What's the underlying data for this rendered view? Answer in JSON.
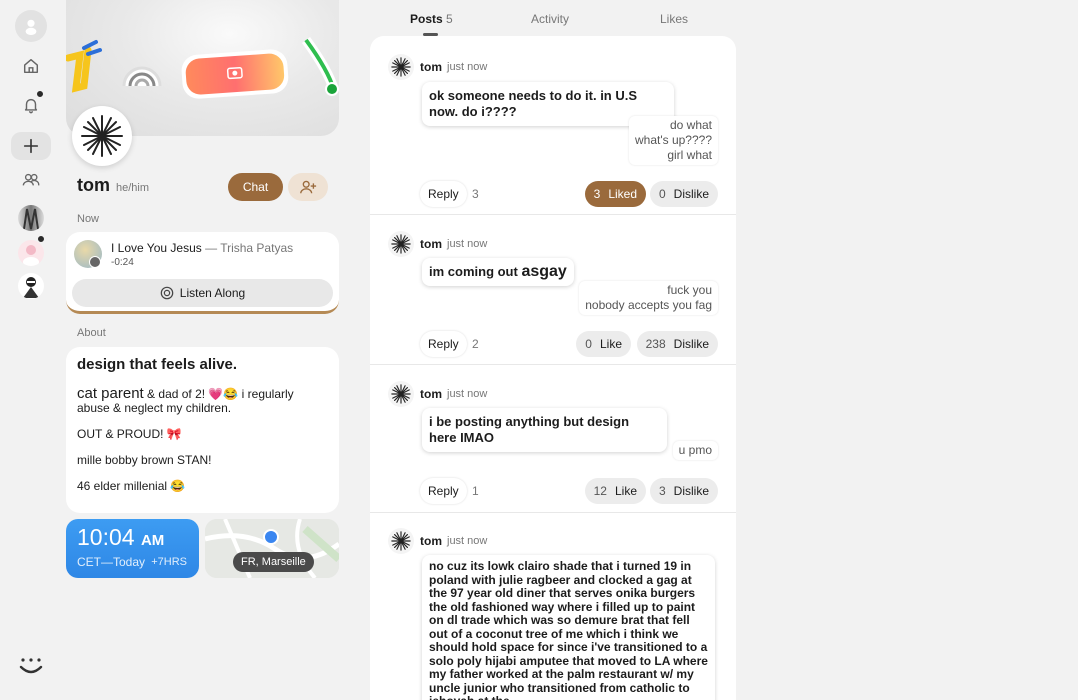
{
  "nav": {
    "items": [
      {
        "name": "home"
      },
      {
        "name": "notifications"
      },
      {
        "name": "create"
      },
      {
        "name": "people"
      }
    ]
  },
  "profile": {
    "name": "tom",
    "pronouns": "he/him",
    "chat_label": "Chat",
    "now_label": "Now",
    "now_playing": {
      "title": "I Love You Jesus",
      "separator": " — ",
      "artist": "Trisha Patyas",
      "time": "-0:24",
      "listen_label": "Listen Along"
    },
    "about_label": "About",
    "about": {
      "headline": "design that feels alive.",
      "line1_big": "cat parent",
      "line1_rest": " & dad of 2! 💗😂 i regularly abuse & neglect my children.",
      "line2": "OUT & PROUD! 🎀",
      "line3": "mille bobby brown STAN!",
      "line4": "46 elder millenial 😂"
    },
    "clock": {
      "time": "10:04",
      "ampm": "AM",
      "tz": "CET—Today",
      "offset": "+7HRS"
    },
    "location": "FR, Marseille"
  },
  "tabs": [
    {
      "label": "Posts",
      "count": "5"
    },
    {
      "label": "Activity"
    },
    {
      "label": "Likes"
    }
  ],
  "posts": [
    {
      "user": "tom",
      "time": "just now",
      "text": "ok someone needs to do it. in U.S now. do i????",
      "replies": [
        "do what",
        "what's up????",
        "girl what"
      ],
      "reply_label": "Reply",
      "reply_count": "3",
      "like_count": "3",
      "like_label": "Liked",
      "dislike_count": "0",
      "dislike_label": "Dislike"
    },
    {
      "user": "tom",
      "time": "just now",
      "text_pre": "im coming out ",
      "text_big": "asgay",
      "replies": [
        "fuck you",
        "nobody accepts you fag"
      ],
      "reply_label": "Reply",
      "reply_count": "2",
      "like_count": "0",
      "like_label": "Like",
      "dislike_count": "238",
      "dislike_label": "Dislike"
    },
    {
      "user": "tom",
      "time": "just now",
      "text": "i be posting anything but design here IMAO",
      "replies": [
        "u pmo"
      ],
      "reply_label": "Reply",
      "reply_count": "1",
      "like_count": "12",
      "like_label": "Like",
      "dislike_count": "3",
      "dislike_label": "Dislike"
    },
    {
      "user": "tom",
      "time": "just now",
      "text": "no cuz its lowk clairo shade that i turned 19 in poland with julie ragbeer and clocked a gag at the 97 year old diner that serves onika burgers the old fashioned way where i filled up to paint on dl trade which was so demure brat that fell out of a coconut tree of me which i think we should hold space for since i've transitioned to a solo poly hijabi amputee that moved to LA where my father worked at the palm restaurant w/ my uncle junior who transitioned from catholic to jehovah at the"
    }
  ]
}
